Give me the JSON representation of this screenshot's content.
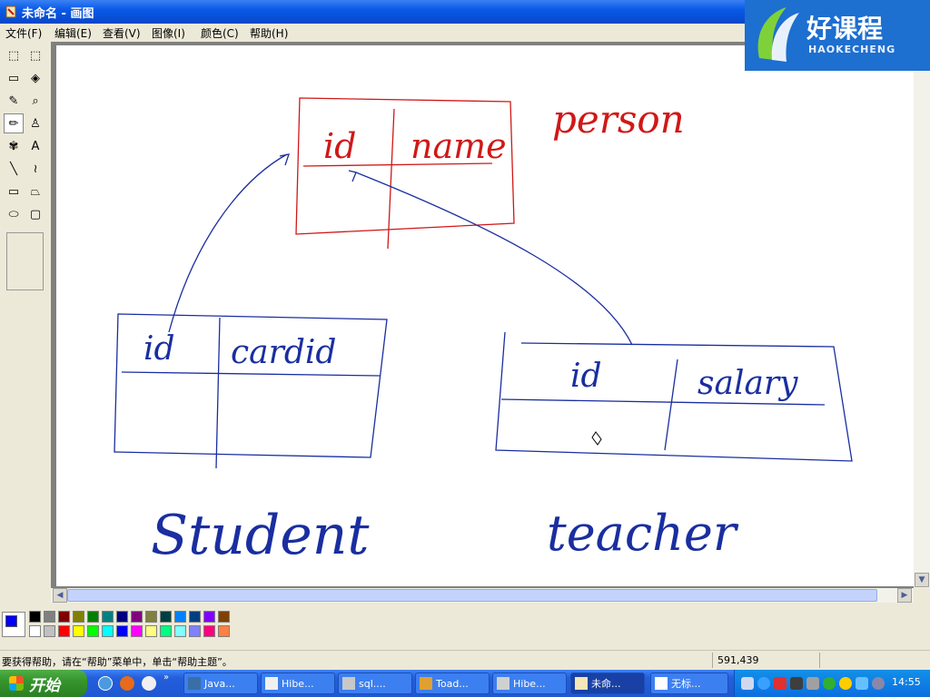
{
  "window": {
    "title": "未命名 - 画图"
  },
  "logo": {
    "main": "好课程",
    "sub": "HAOKECHENG"
  },
  "menu": [
    "文件(F)",
    "编辑(E)",
    "查看(V)",
    "图像(I)",
    "颜色(C)",
    "帮助(H)"
  ],
  "tools": [
    {
      "name": "free-select-icon",
      "glyph": "⬚"
    },
    {
      "name": "rect-select-icon",
      "glyph": "⬚"
    },
    {
      "name": "eraser-icon",
      "glyph": "▭"
    },
    {
      "name": "fill-bucket-icon",
      "glyph": "◈"
    },
    {
      "name": "color-picker-icon",
      "glyph": "✎"
    },
    {
      "name": "magnifier-icon",
      "glyph": "⌕"
    },
    {
      "name": "pencil-icon",
      "glyph": "✏"
    },
    {
      "name": "brush-icon",
      "glyph": "♙"
    },
    {
      "name": "airbrush-icon",
      "glyph": "✾"
    },
    {
      "name": "text-icon",
      "glyph": "A"
    },
    {
      "name": "line-icon",
      "glyph": "╲"
    },
    {
      "name": "curve-icon",
      "glyph": "≀"
    },
    {
      "name": "rectangle-icon",
      "glyph": "▭"
    },
    {
      "name": "polygon-icon",
      "glyph": "⏢"
    },
    {
      "name": "ellipse-icon",
      "glyph": "⬭"
    },
    {
      "name": "rounded-rect-icon",
      "glyph": "▢"
    }
  ],
  "canvas": {
    "labels": {
      "person": "person",
      "student": "Student",
      "teacher": "teacher"
    },
    "person_table": [
      "id",
      "name"
    ],
    "student_table": [
      "id",
      "cardid"
    ],
    "teacher_table": [
      "id",
      "salary"
    ],
    "colors": {
      "red": "#d01818",
      "blue": "#1a2ea0"
    }
  },
  "palette": {
    "primary": "#0000ff",
    "secondary": "#ffffff",
    "row1": [
      "#000000",
      "#808080",
      "#800000",
      "#808000",
      "#008000",
      "#008080",
      "#000080",
      "#800080",
      "#808040",
      "#004040",
      "#0080ff",
      "#004080",
      "#8000ff",
      "#804000"
    ],
    "row2": [
      "#ffffff",
      "#c0c0c0",
      "#ff0000",
      "#ffff00",
      "#00ff00",
      "#00ffff",
      "#0000ff",
      "#ff00ff",
      "#ffff80",
      "#00ff80",
      "#80ffff",
      "#8080ff",
      "#ff0080",
      "#ff8040"
    ]
  },
  "status": {
    "help": "要获得帮助，请在“帮助”菜单中，单击“帮助主题”。",
    "coords": "591,439"
  },
  "taskbar": {
    "start": "开始",
    "tasks": [
      "Java...",
      "Hibe...",
      "sql....",
      "Toad...",
      "Hibe...",
      "未命...",
      "无标..."
    ],
    "clock": "14:55"
  }
}
